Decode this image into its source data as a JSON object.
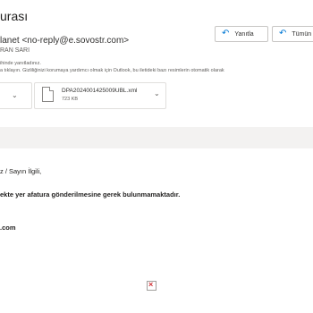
{
  "email": {
    "subject": "urası",
    "sender": "lanet <no-reply@e.sovostr.com>",
    "recipient": "RAN SARI",
    "info_line1": "ihinde yanıtladınız.",
    "info_line2": "a tıklayın. Gizliliğinizi korumaya yardımcı olmak için Outlook, bu iletideki bazı resimlerin otomatik olarak"
  },
  "actions": {
    "reply_label": "Yanıtla",
    "reply_all_label": "Tümün",
    "reply_icon": "reply-arrow-icon",
    "reply_all_icon": "reply-all-arrow-icon"
  },
  "attachments": [
    {
      "name": "",
      "size": ""
    },
    {
      "name": "DPA2024001425009UBL.xml",
      "size": "723 KB"
    }
  ],
  "body": {
    "greeting": "z / Sayın İlgili,",
    "line2": "ekte yer afatura gönderilmesine gerek bulunmamaktadır.",
    "signature": ".com"
  },
  "colors": {
    "accent": "#0078d4",
    "band": "#f3f2f1",
    "broken_image": "#d13438"
  }
}
